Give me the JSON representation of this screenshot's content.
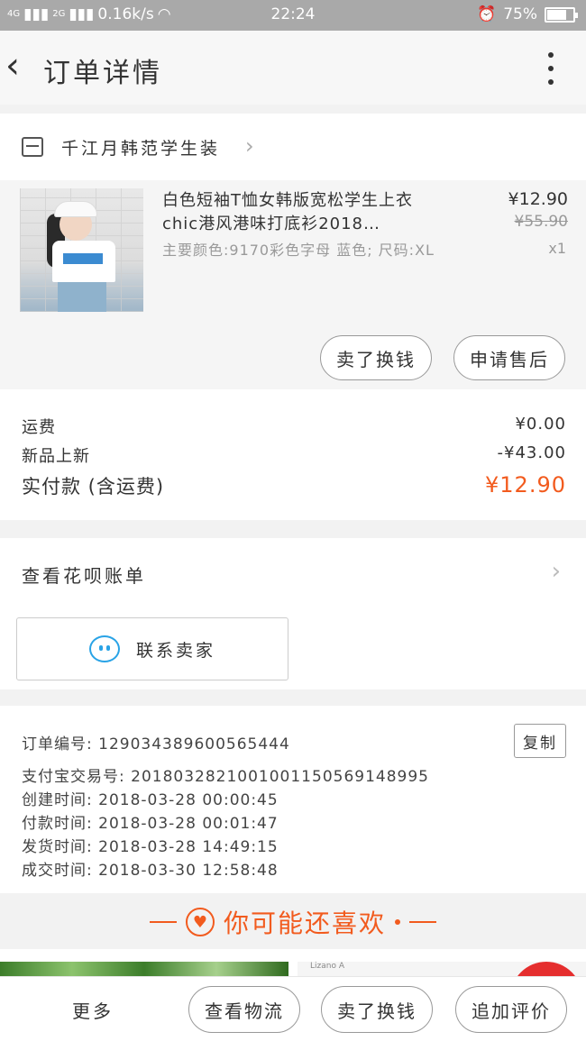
{
  "status_bar": {
    "signal1": "4G",
    "signal2": "2G",
    "speed": "0.16k/s",
    "time": "22:24",
    "battery": "75%",
    "battery_level": 0.75
  },
  "nav": {
    "title": "订单详情"
  },
  "store": {
    "name": "千江月韩范学生装"
  },
  "product": {
    "title": "白色短袖T恤女韩版宽松学生上衣chic港风港味打底衫2018…",
    "spec": "主要颜色:9170彩色字母 蓝色; 尺码:XL",
    "price": "¥12.90",
    "original_price": "¥55.90",
    "quantity": "x1",
    "btn_exchange": "卖了换钱",
    "btn_aftersale": "申请售后"
  },
  "fees": {
    "shipping_label": "运费",
    "shipping_value": "¥0.00",
    "new_label": "新品上新",
    "new_value": "-¥43.00",
    "total_label": "实付款 (含运费)",
    "total_value": "¥12.90"
  },
  "huabei": {
    "label": "查看花呗账单",
    "contact_label": "联系卖家"
  },
  "order_info": {
    "order_no": "订单编号: 129034389600565444",
    "copy": "复制",
    "alipay_no": "支付宝交易号: 2018032821001001150569148995",
    "created": "创建时间: 2018-03-28 00:00:45",
    "paid": "付款时间: 2018-03-28 00:01:47",
    "shipped": "发货时间: 2018-03-28 14:49:15",
    "completed": "成交时间: 2018-03-30 12:58:48"
  },
  "recommend": {
    "heading": "你可能还喜欢",
    "img2_text": "Lizano A"
  },
  "bottom_bar": {
    "more": "更多",
    "track": "查看物流",
    "exchange": "卖了换钱",
    "review": "追加评价"
  },
  "colors": {
    "accent": "#f25b1e",
    "contact_icon": "#29a3e6"
  }
}
